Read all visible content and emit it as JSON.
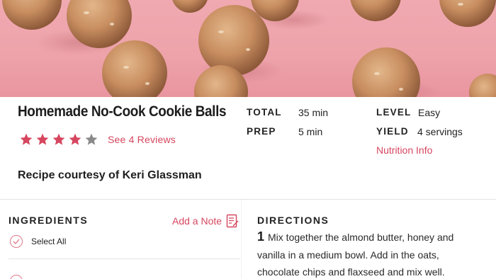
{
  "recipe": {
    "title": "Homemade No-Cook Cookie Balls",
    "rating": {
      "stars": 4,
      "max": 5,
      "reviews_label": "See 4 Reviews"
    },
    "courtesy": "Recipe courtesy of Keri Glassman"
  },
  "meta": {
    "total_label": "TOTAL",
    "total_value": "35 min",
    "prep_label": "PREP",
    "prep_value": "5 min",
    "level_label": "LEVEL",
    "level_value": "Easy",
    "yield_label": "YIELD",
    "yield_value": "4 servings",
    "nutrition_link": "Nutrition Info"
  },
  "ingredients": {
    "heading": "INGREDIENTS",
    "add_note": "Add a Note",
    "select_all": "Select All"
  },
  "directions": {
    "heading": "DIRECTIONS",
    "step_number": "1",
    "step_text": "Mix together the almond butter, honey and vanilla in a medium bowl. Add in the oats, chocolate chips and flaxseed and mix well."
  },
  "colors": {
    "accent": "#d6475f",
    "star_filled": "#d6475f",
    "star_empty": "#8a8a8a",
    "hero_background": "#eea3aa"
  },
  "icons": {
    "star": "star-icon",
    "note": "note-edit-icon",
    "check": "checkmark-icon"
  }
}
